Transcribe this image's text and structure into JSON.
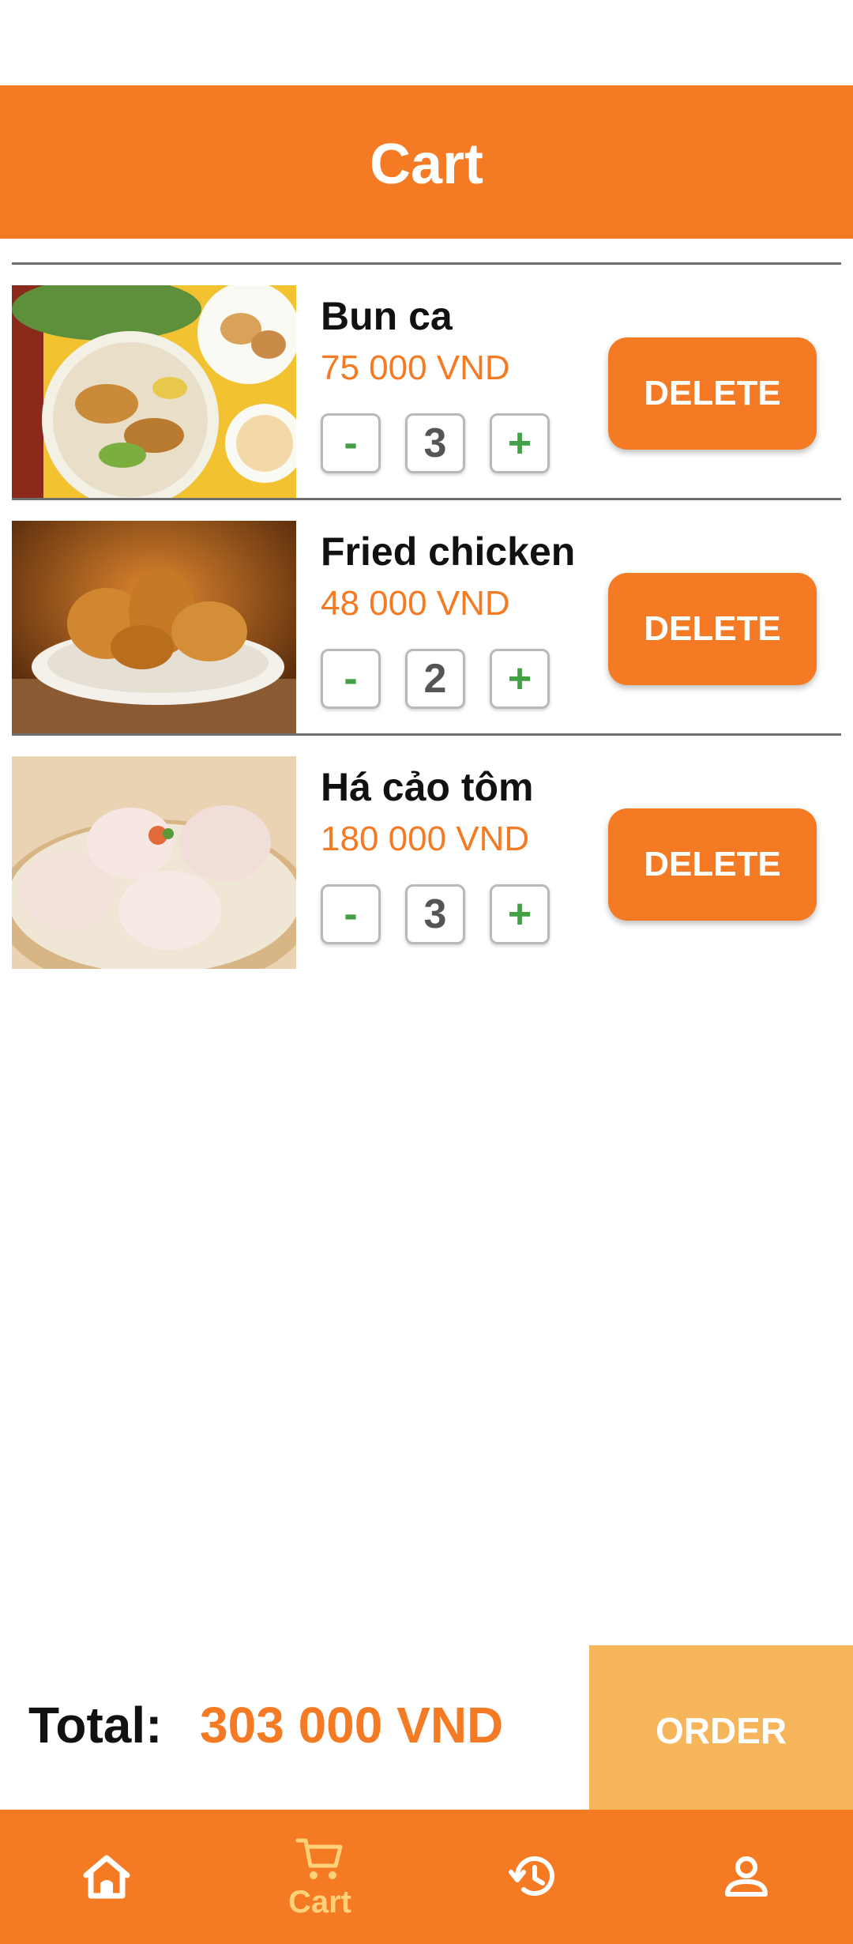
{
  "header": {
    "title": "Cart"
  },
  "cart": {
    "items": [
      {
        "name": "Bun ca",
        "price": "75 000 VND",
        "quantity": "3",
        "minus_label": "-",
        "plus_label": "+",
        "delete_label": "DELETE"
      },
      {
        "name": "Fried chicken",
        "price": "48 000 VND",
        "quantity": "2",
        "minus_label": "-",
        "plus_label": "+",
        "delete_label": "DELETE"
      },
      {
        "name": "Há cảo tôm",
        "price": "180 000 VND",
        "quantity": "3",
        "minus_label": "-",
        "plus_label": "+",
        "delete_label": "DELETE"
      }
    ]
  },
  "footer": {
    "total_label": "Total:",
    "total_value": "303 000 VND",
    "order_label": "ORDER"
  },
  "nav": {
    "items": [
      {
        "icon": "home-icon",
        "label": ""
      },
      {
        "icon": "cart-icon",
        "label": "Cart",
        "active": true
      },
      {
        "icon": "history-icon",
        "label": ""
      },
      {
        "icon": "profile-icon",
        "label": ""
      }
    ]
  },
  "colors": {
    "accent": "#F47B24",
    "order_button": "#F6B55A",
    "active_nav": "#FFD27A",
    "qty_sign": "#43A047"
  }
}
